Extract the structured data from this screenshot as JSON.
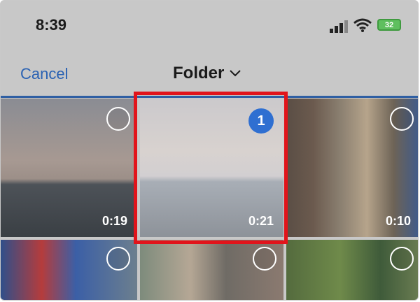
{
  "status_bar": {
    "time": "8:39",
    "battery": "32"
  },
  "header": {
    "cancel_label": "Cancel",
    "folder_label": "Folder",
    "chevron_icon": "chevron-down-icon"
  },
  "grid": {
    "items": [
      {
        "duration": "0:19",
        "selected": false
      },
      {
        "duration": "0:21",
        "selected": true,
        "badge": "1"
      },
      {
        "duration": "0:10",
        "selected": false
      },
      {
        "duration": "",
        "selected": false
      },
      {
        "duration": "",
        "selected": false
      },
      {
        "duration": "",
        "selected": false
      }
    ]
  },
  "colors": {
    "accent": "#2a62b3",
    "highlight": "#e1141b",
    "badge": "#2f6fd1",
    "battery": "#5fbf5f"
  }
}
